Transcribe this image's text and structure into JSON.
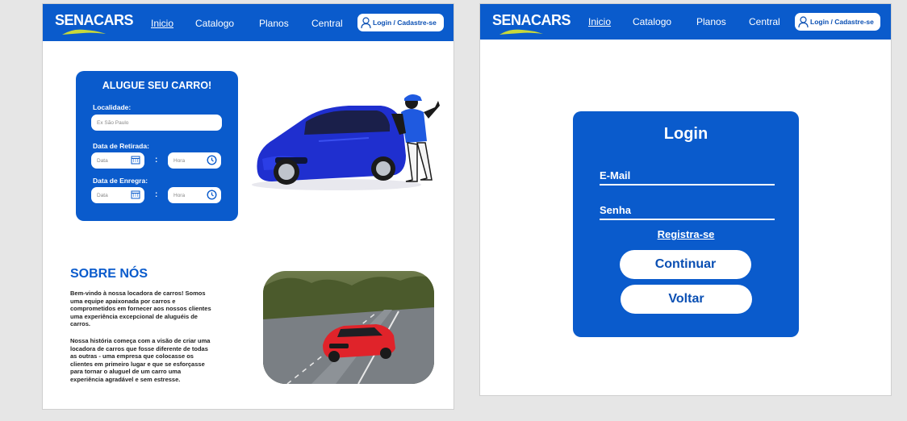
{
  "nav": {
    "logo": "SENACARS",
    "links": [
      "Inicio",
      "Catalogo",
      "Planos",
      "Central"
    ],
    "login_label": "Login / Cadastre-se"
  },
  "rent": {
    "title": "ALUGUE SEU CARRO!",
    "location_label": "Localidade:",
    "location_placeholder": "Ex São Paulo",
    "pickup_label": "Data de Retirada:",
    "return_label": "Data de Enregra:",
    "date_placeholder": "Data",
    "time_placeholder": "Hora",
    "separator": ":"
  },
  "about": {
    "title": "SOBRE NÓS",
    "para1": "  Bem-vindo à nossa locadora de carros! Somos\numa equipe apaixonada por carros e\ncomprometidos em fornecer aos nossos clientes\numa experiência excepcional de aluguéis de\ncarros.",
    "para2": "  Nossa história começa com a visão de criar uma\nlocadora de carros que fosse  diferente de todas\nas outras - uma empresa que colocasse os\nclientes em primeiro lugar e que se esforçasse\npara tornar o aluguel de um carro uma\nexperiência agradável e sem estresse."
  },
  "login": {
    "title": "Login",
    "email_label": "E-Mail",
    "password_label": "Senha",
    "register_link": "Registra-se",
    "continue_label": "Continuar",
    "back_label": "Voltar"
  },
  "colors": {
    "brand_blue": "#0a5bcc",
    "logo_accent": "#c8d93a",
    "white": "#ffffff"
  }
}
